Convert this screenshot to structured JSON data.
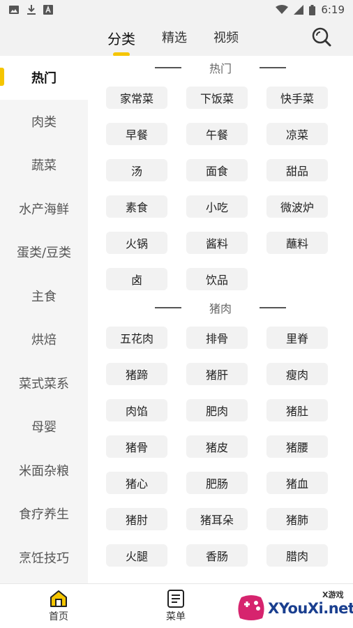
{
  "status_bar": {
    "time": "6:19",
    "left_icons": [
      "image-icon",
      "download-icon",
      "text-box-icon"
    ],
    "right_icons": [
      "wifi-icon",
      "signal-icon",
      "battery-icon"
    ]
  },
  "top_tabs": {
    "items": [
      {
        "label": "分类",
        "active": true
      },
      {
        "label": "精选",
        "active": false
      },
      {
        "label": "视频",
        "active": false
      }
    ],
    "search_icon": "search-icon"
  },
  "sidebar": {
    "items": [
      {
        "label": "热门",
        "active": true
      },
      {
        "label": "肉类",
        "active": false
      },
      {
        "label": "蔬菜",
        "active": false
      },
      {
        "label": "水产海鲜",
        "active": false
      },
      {
        "label": "蛋类/豆类",
        "active": false
      },
      {
        "label": "主食",
        "active": false
      },
      {
        "label": "烘焙",
        "active": false
      },
      {
        "label": "菜式菜系",
        "active": false
      },
      {
        "label": "母婴",
        "active": false
      },
      {
        "label": "米面杂粮",
        "active": false
      },
      {
        "label": "食疗养生",
        "active": false
      },
      {
        "label": "烹饪技巧",
        "active": false
      }
    ]
  },
  "sections": [
    {
      "title": "热门",
      "tags": [
        "家常菜",
        "下饭菜",
        "快手菜",
        "早餐",
        "午餐",
        "凉菜",
        "汤",
        "面食",
        "甜品",
        "素食",
        "小吃",
        "微波炉",
        "火锅",
        "酱料",
        "蘸料",
        "卤",
        "饮品"
      ]
    },
    {
      "title": "猪肉",
      "tags": [
        "五花肉",
        "排骨",
        "里脊",
        "猪蹄",
        "猪肝",
        "瘦肉",
        "肉馅",
        "肥肉",
        "猪肚",
        "猪骨",
        "猪皮",
        "猪腰",
        "猪心",
        "肥肠",
        "猪血",
        "猪肘",
        "猪耳朵",
        "猪肺",
        "火腿",
        "香肠",
        "腊肉"
      ]
    }
  ],
  "bottom_nav": {
    "items": [
      {
        "label": "首页",
        "icon": "home-icon",
        "active": true
      },
      {
        "label": "菜单",
        "icon": "menu-list-icon",
        "active": false
      }
    ]
  },
  "watermark": {
    "text": "XYouXi.net",
    "small_text": "X游戏"
  },
  "colors": {
    "accent": "#f5c500",
    "tag_bg": "#f2f2f2",
    "sidebar_bg": "#f5f5f5"
  }
}
